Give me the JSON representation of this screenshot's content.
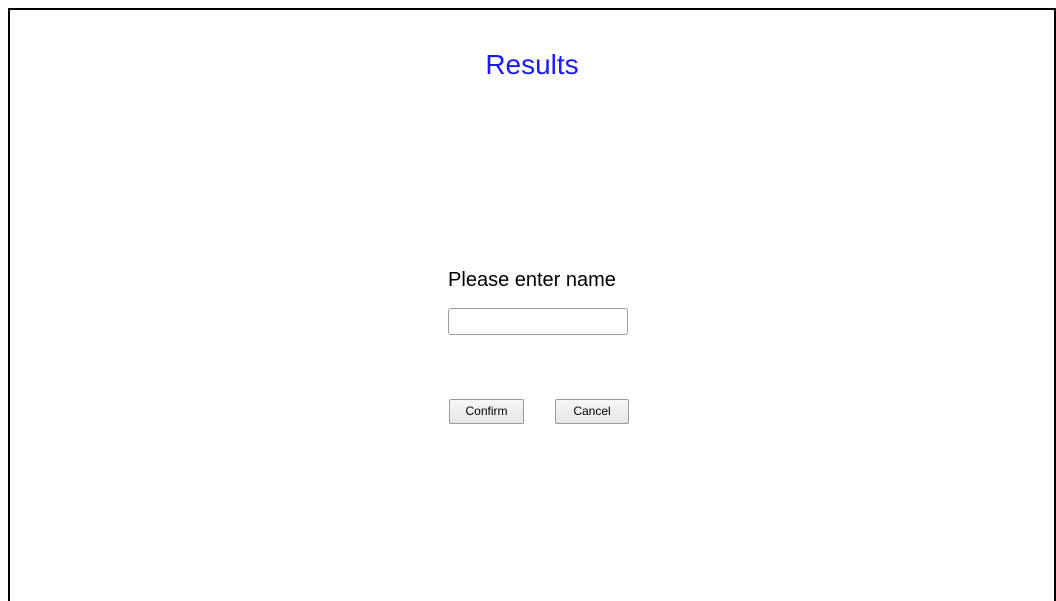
{
  "page": {
    "title": "Results",
    "colors": {
      "title": "#1a1aff",
      "border": "#000000",
      "background": "#ffffff"
    }
  },
  "form": {
    "prompt": "Please enter name",
    "name_input": {
      "value": "",
      "placeholder": ""
    },
    "confirm_label": "Confirm",
    "cancel_label": "Cancel"
  }
}
